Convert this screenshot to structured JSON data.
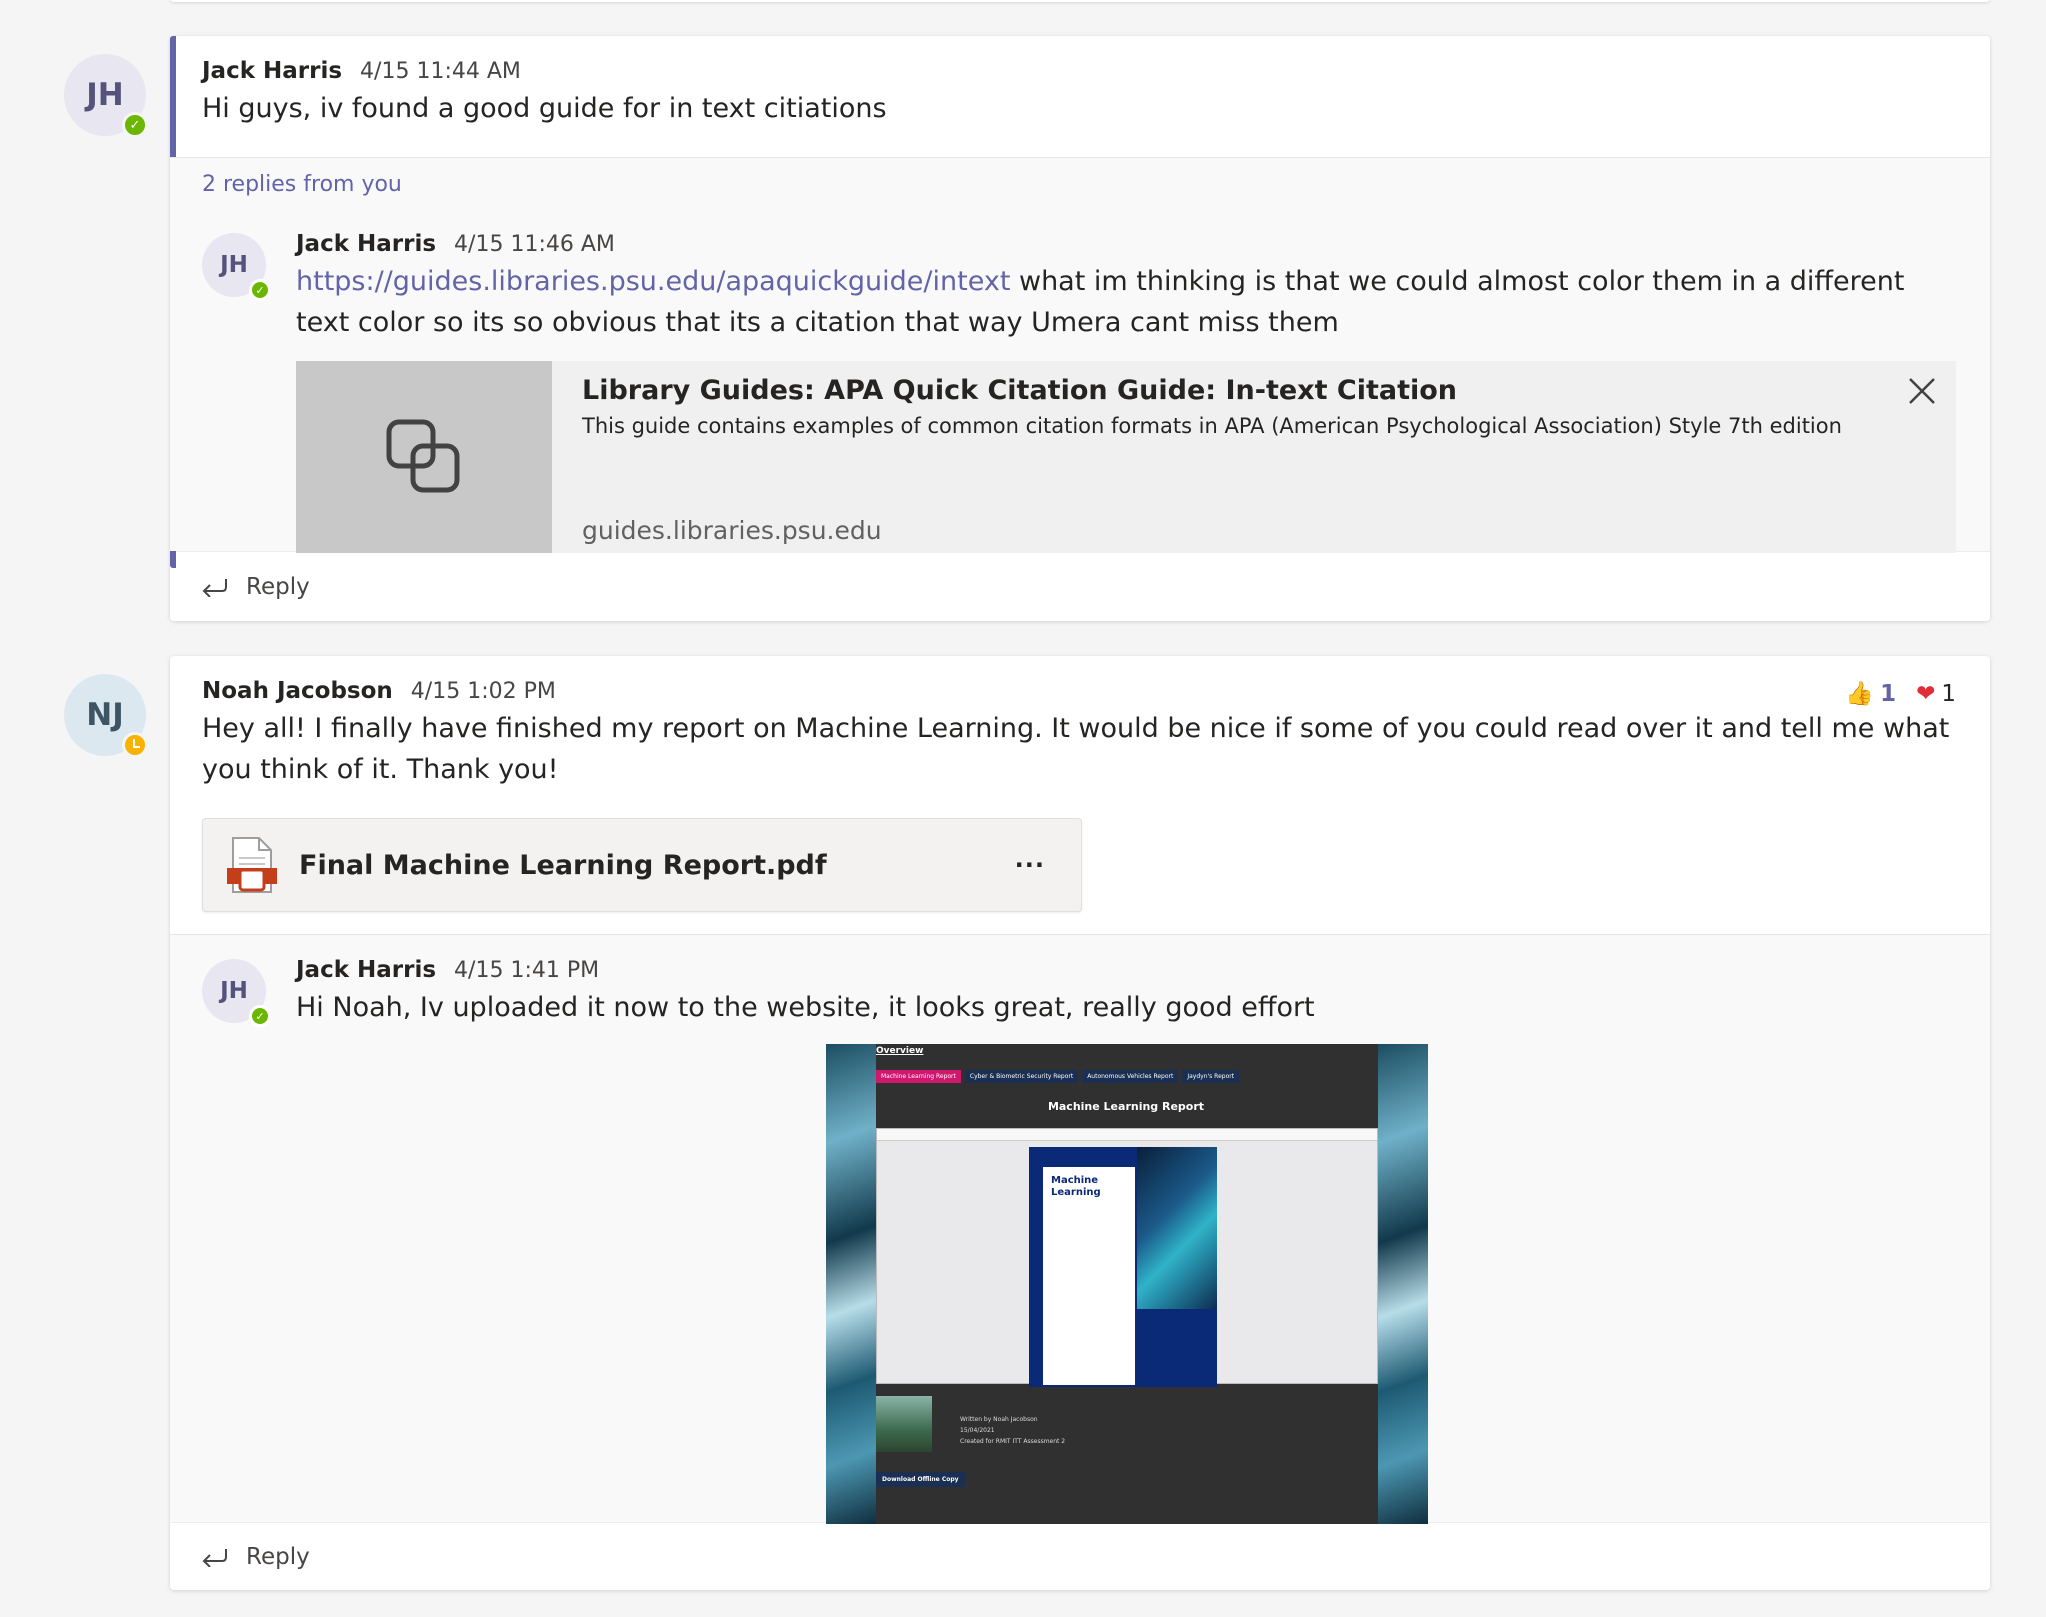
{
  "thread1": {
    "avatar_initials": "JH",
    "author": "Jack Harris",
    "time": "4/15 11:44 AM",
    "message": "Hi guys, iv found a good guide for in text citiations",
    "replies_summary": "2 replies from you",
    "reply": {
      "avatar_initials": "JH",
      "author": "Jack Harris",
      "time": "4/15 11:46 AM",
      "link": "https://guides.libraries.psu.edu/apaquickguide/intext",
      "message": " what im thinking is that we could almost color them in a different text color so its so obvious that its a citation that way Umera cant miss them",
      "preview": {
        "title": "Library Guides: APA Quick Citation Guide: In-text Citation",
        "description": "This guide contains examples of common citation formats in APA (American Psychological Association) Style 7th edition",
        "domain": "guides.libraries.psu.edu"
      }
    },
    "reply_label": "Reply"
  },
  "thread2": {
    "avatar_initials": "NJ",
    "author": "Noah Jacobson",
    "time": "4/15 1:02 PM",
    "message": "Hey all! I finally have finished my report on Machine Learning. It would be nice if some of you could read over it and tell me what you think of it. Thank you!",
    "reactions": [
      {
        "icon": "thumbs-up-icon",
        "glyph": "👍",
        "count": "1"
      },
      {
        "icon": "heart-icon",
        "glyph": "❤",
        "count": "1"
      }
    ],
    "attachment": {
      "file_name": "Final Machine Learning Report.pdf",
      "more": "···"
    },
    "reply": {
      "avatar_initials": "JH",
      "author": "Jack Harris",
      "time": "4/15 1:41 PM",
      "message": "Hi Noah, Iv uploaded it now to the website, it looks great, really good effort",
      "screenshot": {
        "overview": "Overview",
        "tabs": [
          "Machine Learning Report",
          "Cyber & Biometric Security Report",
          "Autonomous Vehicles Report",
          "Jaydyn's Report"
        ],
        "title": "Machine Learning Report",
        "page_title_line1": "Machine",
        "page_title_line2": "Learning",
        "written_by": "Written by Noah Jacobson",
        "date": "15/04/2021",
        "created_for": "Created for RMIT ITT Assessment 2",
        "download": "Download Offline Copy"
      }
    },
    "reply_label": "Reply"
  },
  "colors": {
    "accent": "#6264a7",
    "available": "#6bb700",
    "away": "#f8b200",
    "pdf_red": "#c43e1c"
  }
}
